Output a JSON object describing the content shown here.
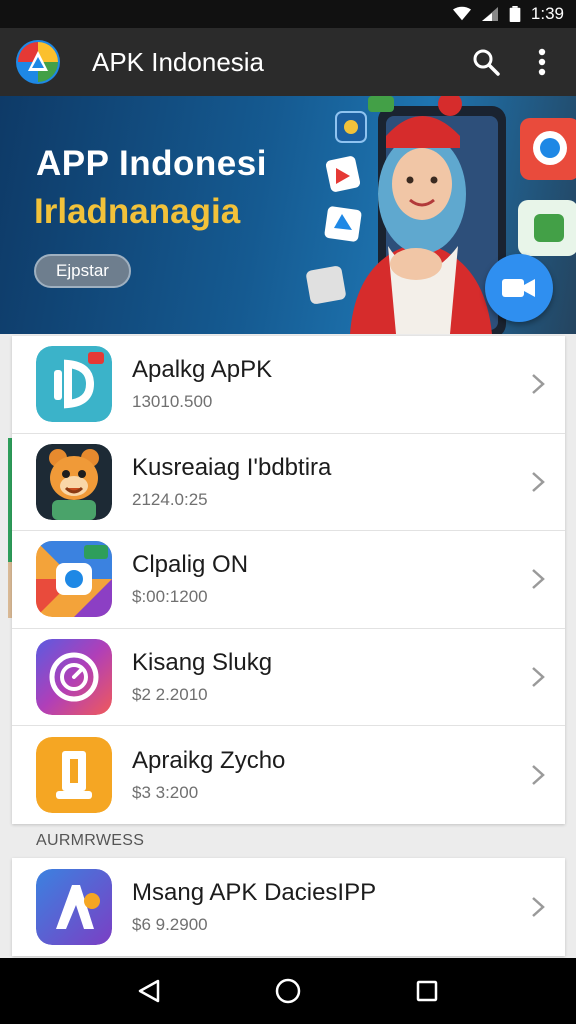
{
  "status_bar": {
    "time": "1:39"
  },
  "app_bar": {
    "title": "APK Indonesia",
    "logo_icon": "apk-logo-icon",
    "actions": [
      "search-icon",
      "more-vert-icon"
    ]
  },
  "banner": {
    "title": "APP Indonesi",
    "subtitle": "Irladnanagia",
    "button_label": "Ejpstar",
    "fab_icon": "video-camera-icon"
  },
  "apps": [
    {
      "name": "Apalkg ApPK",
      "meta": "13010.500",
      "icon": "app-d-icon",
      "color": "#3bb3c9"
    },
    {
      "name": "Kusreaiag I'bdbtira",
      "meta": "2124.0:25",
      "icon": "mascot-app-icon",
      "color": "#1d2a35"
    },
    {
      "name": "Clpalig ON",
      "meta": "$:00:1200",
      "icon": "camera-app-icon",
      "color": "#f3a33a"
    },
    {
      "name": "Kisang Slukg",
      "meta": "$2 2.2010",
      "icon": "clock-app-icon",
      "color": "#8b3fc4"
    },
    {
      "name": "Apraikg Zycho",
      "meta": "$3 3:200",
      "icon": "document-app-icon",
      "color": "#f5a623"
    }
  ],
  "section_header": "AURMRWESS",
  "featured_app": {
    "name": "Msang APK DaciesIPP",
    "meta": "$6 9.2900",
    "icon": "letter-a-app-icon",
    "color": "#3f6fe0"
  },
  "nav": [
    "back-icon",
    "home-icon",
    "recents-icon"
  ],
  "colors": {
    "accent": "#2f8ff0",
    "banner_subtitle": "#f2c23a",
    "list_accent": "#2e9e5b"
  }
}
